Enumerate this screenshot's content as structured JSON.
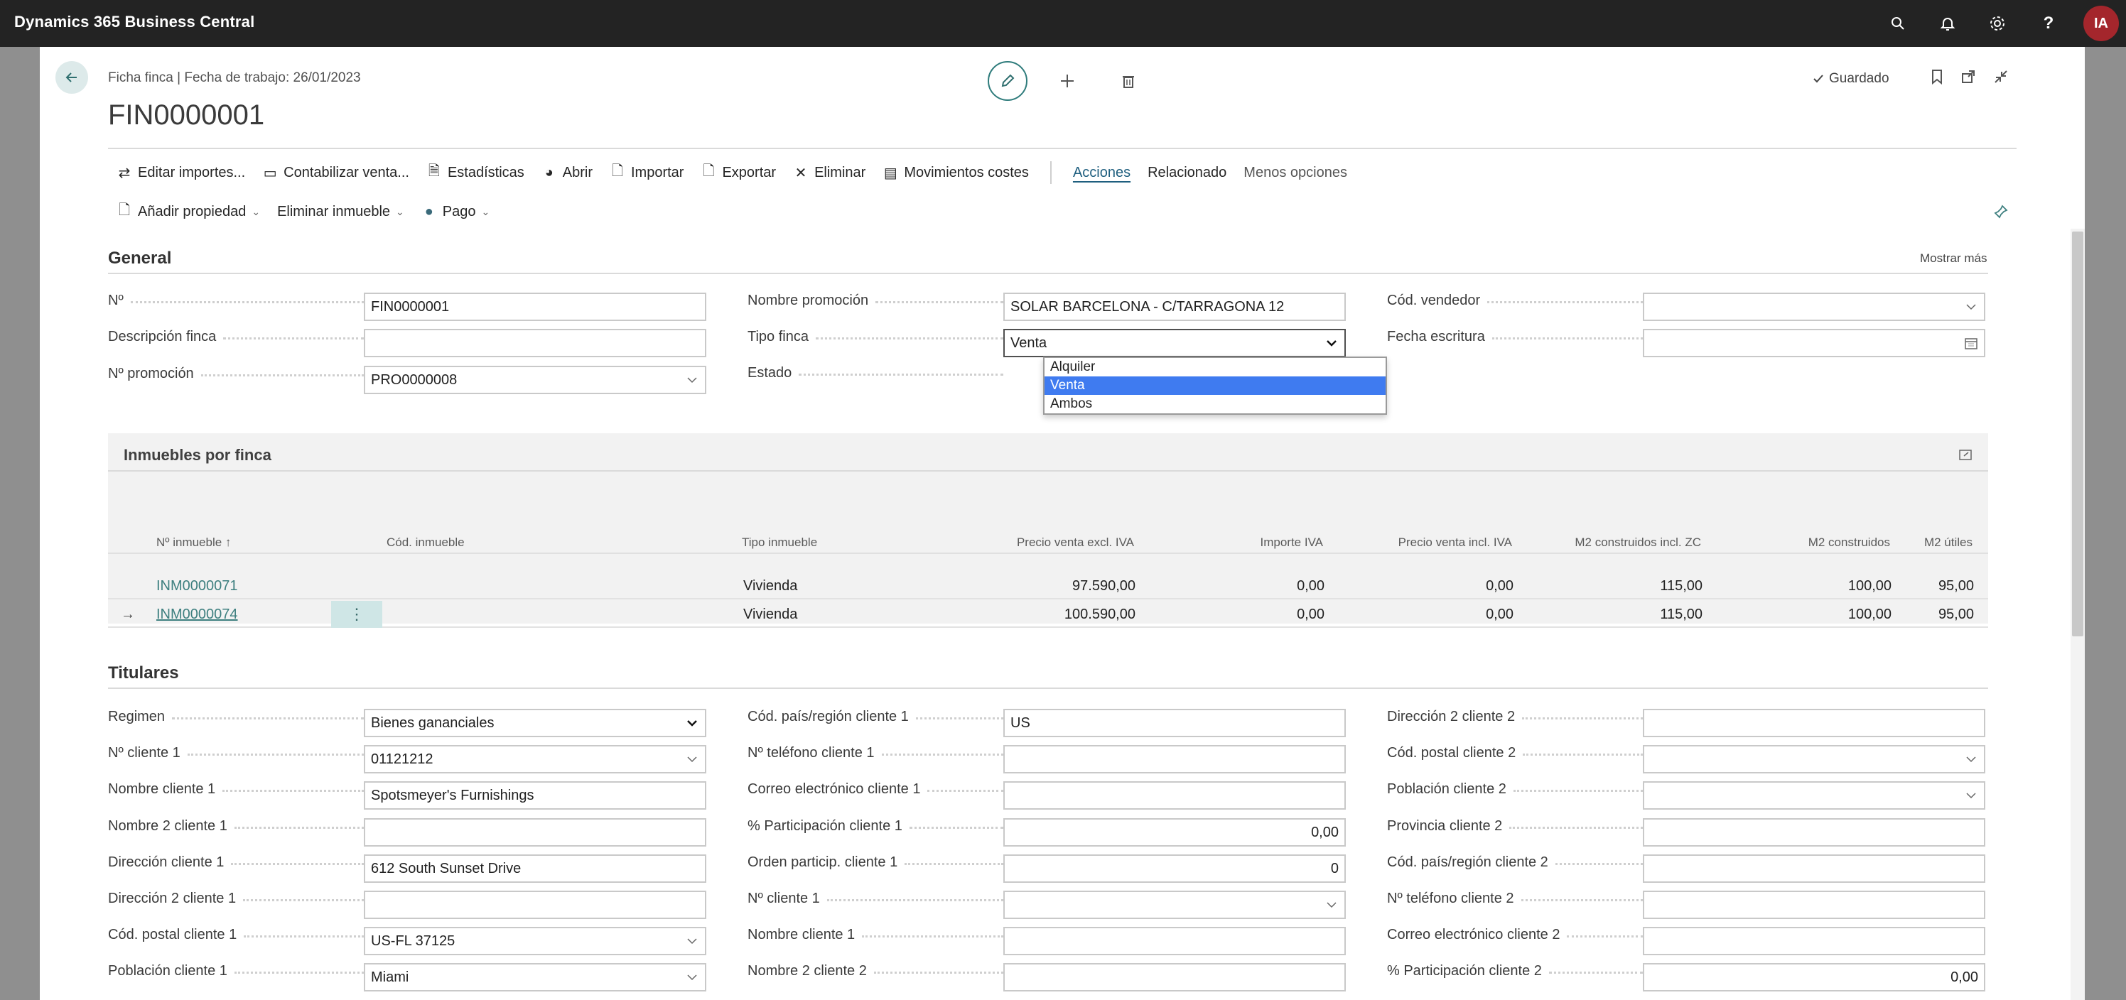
{
  "app": {
    "title": "Dynamics 365 Business Central",
    "user_initials": "IA"
  },
  "header": {
    "breadcrumb": "Ficha finca | Fecha de trabajo: 26/01/2023",
    "record_title": "FIN0000001",
    "saved_label": "Guardado"
  },
  "actions": {
    "row1": [
      "Editar importes...",
      "Contabilizar venta...",
      "Estadísticas",
      "Abrir",
      "Importar",
      "Exportar",
      "Eliminar",
      "Movimientos costes"
    ],
    "tabs": [
      "Acciones",
      "Relacionado",
      "Menos opciones"
    ],
    "row2": [
      "Añadir propiedad",
      "Eliminar inmueble",
      "Pago"
    ]
  },
  "general": {
    "title": "General",
    "show_more": "Mostrar más",
    "fields": {
      "no_label": "Nº",
      "no_value": "FIN0000001",
      "desc_label": "Descripción finca",
      "desc_value": "",
      "promo_no_label": "Nº promoción",
      "promo_no_value": "PRO0000008",
      "promo_name_label": "Nombre promoción",
      "promo_name_value": "SOLAR BARCELONA - C/TARRAGONA 12",
      "tipo_label": "Tipo finca",
      "tipo_value": "Venta",
      "estado_label": "Estado",
      "vendedor_label": "Cód. vendedor",
      "vendedor_value": "",
      "fecha_label": "Fecha escritura",
      "fecha_value": ""
    },
    "tipo_options": [
      "Alquiler",
      "Venta",
      "Ambos"
    ]
  },
  "inmuebles": {
    "title": "Inmuebles por finca",
    "columns": [
      "Nº inmueble ↑",
      "Cód. inmueble",
      "Tipo inmueble",
      "Precio venta excl. IVA",
      "Importe IVA",
      "Precio venta incl. IVA",
      "M2 construidos incl. ZC",
      "M2 construidos",
      "M2 útiles"
    ],
    "rows": [
      {
        "no": "INM0000071",
        "cod": "",
        "tipo": "Vivienda",
        "excl": "97.590,00",
        "iva": "0,00",
        "incl": "0,00",
        "m2zc": "115,00",
        "m2c": "100,00",
        "m2u": "95,00"
      },
      {
        "no": "INM0000074",
        "cod": "",
        "tipo": "Vivienda",
        "excl": "100.590,00",
        "iva": "0,00",
        "incl": "0,00",
        "m2zc": "115,00",
        "m2c": "100,00",
        "m2u": "95,00"
      }
    ]
  },
  "titulares": {
    "title": "Titulares",
    "col1": [
      {
        "label": "Regimen",
        "value": "Bienes gananciales"
      },
      {
        "label": "Nº cliente 1",
        "value": "01121212"
      },
      {
        "label": "Nombre cliente 1",
        "value": "Spotsmeyer's Furnishings"
      },
      {
        "label": "Nombre 2 cliente 1",
        "value": ""
      },
      {
        "label": "Dirección cliente 1",
        "value": "612 South Sunset Drive"
      },
      {
        "label": "Dirección 2 cliente 1",
        "value": ""
      },
      {
        "label": "Cód. postal cliente 1",
        "value": "US-FL 37125"
      },
      {
        "label": "Población cliente 1",
        "value": "Miami"
      }
    ],
    "col2": [
      {
        "label": "Cód. país/región cliente 1",
        "value": "US"
      },
      {
        "label": "Nº teléfono cliente 1",
        "value": ""
      },
      {
        "label": "Correo electrónico cliente 1",
        "value": ""
      },
      {
        "label": "% Participación cliente 1",
        "value": "0,00"
      },
      {
        "label": "Orden particip. cliente 1",
        "value": "0"
      },
      {
        "label": "Nº cliente 1",
        "value": ""
      },
      {
        "label": "Nombre cliente 1",
        "value": ""
      },
      {
        "label": "Nombre 2 cliente 2",
        "value": ""
      }
    ],
    "col3": [
      {
        "label": "Dirección 2 cliente 2",
        "value": ""
      },
      {
        "label": "Cód. postal cliente 2",
        "value": ""
      },
      {
        "label": "Población cliente 2",
        "value": ""
      },
      {
        "label": "Provincia cliente 2",
        "value": ""
      },
      {
        "label": "Cód. país/región cliente 2",
        "value": ""
      },
      {
        "label": "Nº teléfono cliente 2",
        "value": ""
      },
      {
        "label": "Correo electrónico cliente 2",
        "value": ""
      },
      {
        "label": "% Participación cliente 2",
        "value": "0,00"
      }
    ]
  },
  "colors": {
    "topbar": "#232323",
    "accent": "#2f7c7c",
    "link": "#3d7f7f",
    "avatar": "#a4262c",
    "dropdown_selected": "#3f7bf0"
  }
}
